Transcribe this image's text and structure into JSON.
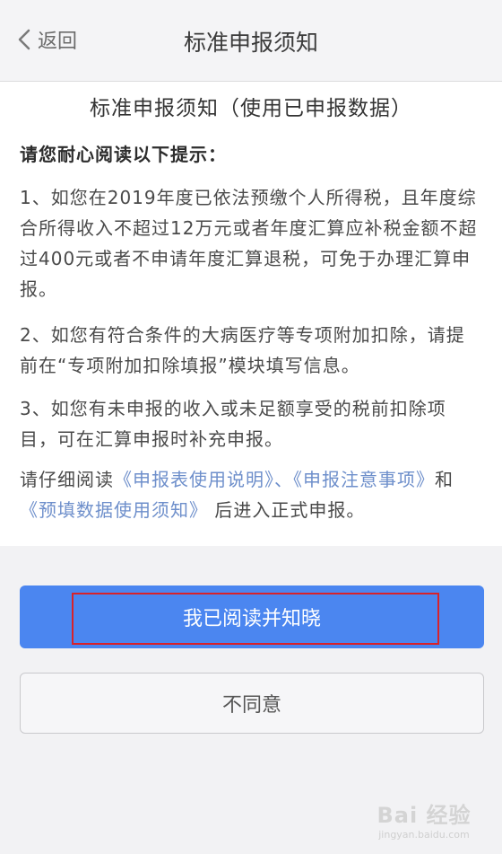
{
  "navbar": {
    "back_label": "返回",
    "title": "标准申报须知"
  },
  "notice": {
    "title": "标准申报须知（使用已申报数据）",
    "intro": "请您耐心阅读以下提示：",
    "items": [
      "1、如您在2019年度已依法预缴个人所得税，且年度综合所得收入不超过12万元或者年度汇算应补税金额不超过400元或者不申请年度汇算退税，可免于办理汇算申报。",
      "2、如您有符合条件的大病医疗等专项附加扣除，请提前在“专项附加扣除填报”模块填写信息。",
      "3、如您有未申报的收入或未足额享受的税前扣除项目，可在汇算申报时补充申报。"
    ],
    "footer": {
      "prefix": "请仔细阅读",
      "link1": "《申报表使用说明》",
      "sep1": "、",
      "link2": "《申报注意事项》",
      "and": "和",
      "link3": "《预填数据使用须知》",
      "suffix": "后进入正式申报。"
    }
  },
  "actions": {
    "agree_label": "我已阅读并知晓",
    "disagree_label": "不同意"
  },
  "watermark": {
    "logo": "Bai 经验",
    "url": "jingyan.baidu.com"
  },
  "colors": {
    "primary": "#4b86f0",
    "link": "#6e8fcb",
    "highlight": "#d8222a"
  }
}
